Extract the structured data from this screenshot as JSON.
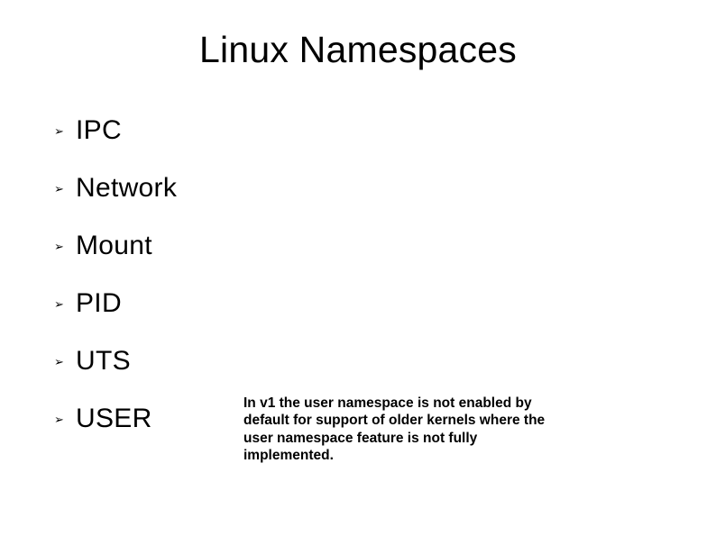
{
  "title": "Linux Namespaces",
  "bullet_glyph": "➢",
  "items": [
    {
      "label": "IPC"
    },
    {
      "label": "Network"
    },
    {
      "label": "Mount"
    },
    {
      "label": "PID"
    },
    {
      "label": "UTS"
    },
    {
      "label": "USER"
    }
  ],
  "note": "In v1 the user namespace is not enabled by default for support of older kernels where the user namespace feature is not fully implemented."
}
